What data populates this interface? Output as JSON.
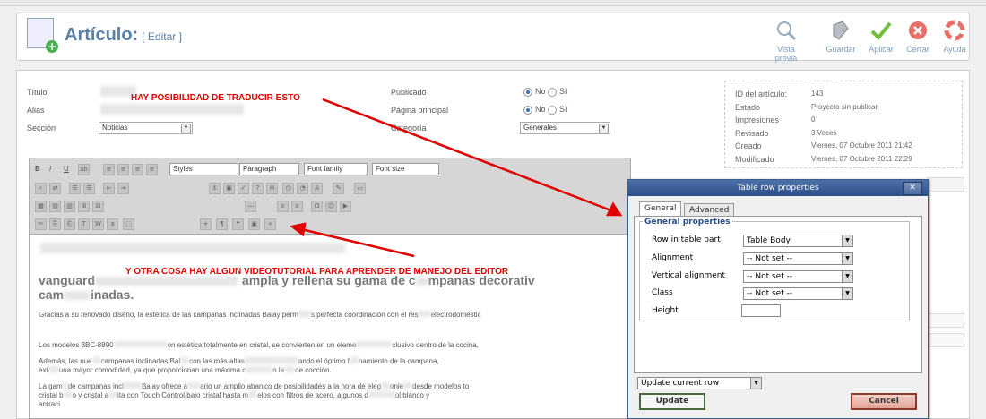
{
  "header": {
    "title": "Artículo:",
    "subtitle": "[ Editar ]",
    "buttons": [
      {
        "label": "Vista previa",
        "icon": "preview-icon",
        "color": "#7a9cc0"
      },
      {
        "label": "Guardar",
        "icon": "save-icon",
        "color": "#7a9cc0"
      },
      {
        "label": "Aplicar",
        "icon": "apply-icon",
        "color": "#7a9cc0"
      },
      {
        "label": "Cerrar",
        "icon": "close-icon",
        "color": "#7a9cc0"
      },
      {
        "label": "Ayuda",
        "icon": "help-icon",
        "color": "#7a9cc0"
      }
    ]
  },
  "form": {
    "titulo_label": "Título",
    "alias_label": "Alias",
    "seccion_label": "Sección",
    "seccion_value": "Noticias",
    "publicado_label": "Publicado",
    "pagina_label": "Página principal",
    "categoria_label": "Categoría",
    "categoria_value": "Generales",
    "no_label": "No",
    "si_label": "Sí"
  },
  "info": {
    "rows": [
      {
        "label": "ID del artículo:",
        "value": "143"
      },
      {
        "label": "Estado",
        "value": "Proyecto sin publicar"
      },
      {
        "label": "Impresiones",
        "value": "0"
      },
      {
        "label": "Revisado",
        "value": "3 Veces"
      },
      {
        "label": "Creado",
        "value": "Viernes, 07 Octubre 2011 21:42"
      },
      {
        "label": "Modificado",
        "value": "Viernes, 07 Octubre 2011 22:29"
      }
    ]
  },
  "annotations": {
    "first": "HAY POSIBILIDAD DE TRADUCIR ESTO",
    "second": "Y OTRA COSA HAY ALGUN VIDEOTUTORIAL PARA APRENDER DE MANEJO DEL EDITOR",
    "color": "#e00000"
  },
  "editor": {
    "styles": "Styles",
    "paragraph": "Paragraph",
    "font_family": "Font family",
    "font_size": "Font size",
    "heading_start": "vanguard",
    "heading_mid": "ampla y rellena su gama de c",
    "heading_end": "mpanas decorativ",
    "heading_cont": "cam",
    "heading_cont2": "inadas.",
    "lines": [
      "Gracias a su renovado diseño, la estética de las campanas inclinadas Balay perm",
      "s perfecta coordinación con el res",
      "electrodoméstic",
      "Los modelos 3BC-8890",
      "on estética totalmente en cristal, se convierten en un eleme",
      "clusivo dentro de la cocina,",
      "Además, las nue",
      "campanas inclinadas Bal",
      "con las más altas",
      "ando el óptimo f",
      "namiento de la campana,",
      "ext",
      "una mayor comodidad, ya que proporcionan una máxima c",
      "n la",
      "de cocción.",
      "La gam",
      "de campanas incl",
      "Balay ofrece a",
      "ario un amplio abanico de posibilidades a la hora de eleg",
      "onie",
      "desde modelos to",
      "cristal b",
      "o y cristal a",
      "ita con Touch Control bajo cristal hasta m",
      "elos con filtros de acero, algunos d",
      "ol blanco y",
      "antraci"
    ]
  },
  "dialog": {
    "title": "Table row properties",
    "tab_general": "General",
    "tab_advanced": "Advanced",
    "legend": "General properties",
    "fields": [
      {
        "label": "Row in table part",
        "value": "Table Body"
      },
      {
        "label": "Alignment",
        "value": "-- Not set --"
      },
      {
        "label": "Vertical alignment",
        "value": "-- Not set --"
      },
      {
        "label": "Class",
        "value": "-- Not set --"
      },
      {
        "label": "Height",
        "value": ""
      }
    ],
    "update_select": "Update current row",
    "update_button": "Update",
    "cancel_button": "Cancel"
  }
}
